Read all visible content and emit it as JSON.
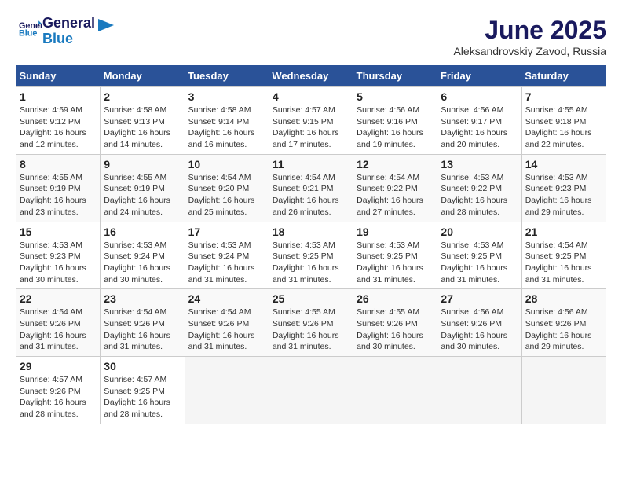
{
  "header": {
    "logo_line1": "General",
    "logo_line2": "Blue",
    "month_title": "June 2025",
    "subtitle": "Aleksandrovskiy Zavod, Russia"
  },
  "days_of_week": [
    "Sunday",
    "Monday",
    "Tuesday",
    "Wednesday",
    "Thursday",
    "Friday",
    "Saturday"
  ],
  "weeks": [
    [
      {
        "day": "1",
        "sunrise": "4:59 AM",
        "sunset": "9:12 PM",
        "daylight": "16 hours and 12 minutes."
      },
      {
        "day": "2",
        "sunrise": "4:58 AM",
        "sunset": "9:13 PM",
        "daylight": "16 hours and 14 minutes."
      },
      {
        "day": "3",
        "sunrise": "4:58 AM",
        "sunset": "9:14 PM",
        "daylight": "16 hours and 16 minutes."
      },
      {
        "day": "4",
        "sunrise": "4:57 AM",
        "sunset": "9:15 PM",
        "daylight": "16 hours and 17 minutes."
      },
      {
        "day": "5",
        "sunrise": "4:56 AM",
        "sunset": "9:16 PM",
        "daylight": "16 hours and 19 minutes."
      },
      {
        "day": "6",
        "sunrise": "4:56 AM",
        "sunset": "9:17 PM",
        "daylight": "16 hours and 20 minutes."
      },
      {
        "day": "7",
        "sunrise": "4:55 AM",
        "sunset": "9:18 PM",
        "daylight": "16 hours and 22 minutes."
      }
    ],
    [
      {
        "day": "8",
        "sunrise": "4:55 AM",
        "sunset": "9:19 PM",
        "daylight": "16 hours and 23 minutes."
      },
      {
        "day": "9",
        "sunrise": "4:55 AM",
        "sunset": "9:19 PM",
        "daylight": "16 hours and 24 minutes."
      },
      {
        "day": "10",
        "sunrise": "4:54 AM",
        "sunset": "9:20 PM",
        "daylight": "16 hours and 25 minutes."
      },
      {
        "day": "11",
        "sunrise": "4:54 AM",
        "sunset": "9:21 PM",
        "daylight": "16 hours and 26 minutes."
      },
      {
        "day": "12",
        "sunrise": "4:54 AM",
        "sunset": "9:22 PM",
        "daylight": "16 hours and 27 minutes."
      },
      {
        "day": "13",
        "sunrise": "4:53 AM",
        "sunset": "9:22 PM",
        "daylight": "16 hours and 28 minutes."
      },
      {
        "day": "14",
        "sunrise": "4:53 AM",
        "sunset": "9:23 PM",
        "daylight": "16 hours and 29 minutes."
      }
    ],
    [
      {
        "day": "15",
        "sunrise": "4:53 AM",
        "sunset": "9:23 PM",
        "daylight": "16 hours and 30 minutes."
      },
      {
        "day": "16",
        "sunrise": "4:53 AM",
        "sunset": "9:24 PM",
        "daylight": "16 hours and 30 minutes."
      },
      {
        "day": "17",
        "sunrise": "4:53 AM",
        "sunset": "9:24 PM",
        "daylight": "16 hours and 31 minutes."
      },
      {
        "day": "18",
        "sunrise": "4:53 AM",
        "sunset": "9:25 PM",
        "daylight": "16 hours and 31 minutes."
      },
      {
        "day": "19",
        "sunrise": "4:53 AM",
        "sunset": "9:25 PM",
        "daylight": "16 hours and 31 minutes."
      },
      {
        "day": "20",
        "sunrise": "4:53 AM",
        "sunset": "9:25 PM",
        "daylight": "16 hours and 31 minutes."
      },
      {
        "day": "21",
        "sunrise": "4:54 AM",
        "sunset": "9:25 PM",
        "daylight": "16 hours and 31 minutes."
      }
    ],
    [
      {
        "day": "22",
        "sunrise": "4:54 AM",
        "sunset": "9:26 PM",
        "daylight": "16 hours and 31 minutes."
      },
      {
        "day": "23",
        "sunrise": "4:54 AM",
        "sunset": "9:26 PM",
        "daylight": "16 hours and 31 minutes."
      },
      {
        "day": "24",
        "sunrise": "4:54 AM",
        "sunset": "9:26 PM",
        "daylight": "16 hours and 31 minutes."
      },
      {
        "day": "25",
        "sunrise": "4:55 AM",
        "sunset": "9:26 PM",
        "daylight": "16 hours and 31 minutes."
      },
      {
        "day": "26",
        "sunrise": "4:55 AM",
        "sunset": "9:26 PM",
        "daylight": "16 hours and 30 minutes."
      },
      {
        "day": "27",
        "sunrise": "4:56 AM",
        "sunset": "9:26 PM",
        "daylight": "16 hours and 30 minutes."
      },
      {
        "day": "28",
        "sunrise": "4:56 AM",
        "sunset": "9:26 PM",
        "daylight": "16 hours and 29 minutes."
      }
    ],
    [
      {
        "day": "29",
        "sunrise": "4:57 AM",
        "sunset": "9:26 PM",
        "daylight": "16 hours and 28 minutes."
      },
      {
        "day": "30",
        "sunrise": "4:57 AM",
        "sunset": "9:25 PM",
        "daylight": "16 hours and 28 minutes."
      },
      null,
      null,
      null,
      null,
      null
    ]
  ]
}
